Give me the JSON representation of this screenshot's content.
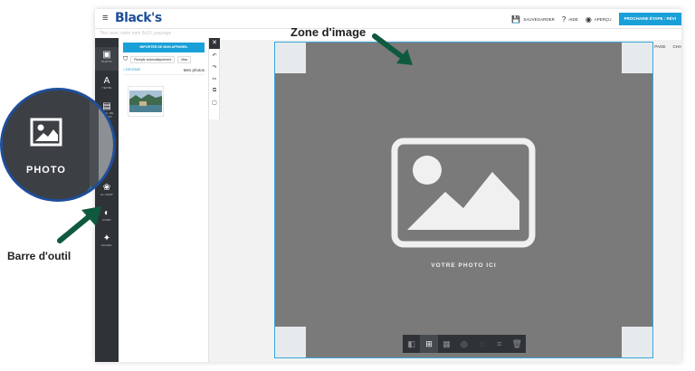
{
  "app": {
    "logo": "Black's",
    "hamburger": "≡",
    "project_title": "Titre avec votre nom 8x10, paysage"
  },
  "top_actions": [
    {
      "icon": "save-icon",
      "glyph": "💾",
      "label": "Sauvegarder"
    },
    {
      "icon": "help-icon",
      "glyph": "?",
      "label": "Aide"
    },
    {
      "icon": "eye-icon",
      "glyph": "◉",
      "label": "Aperçu"
    }
  ],
  "next_button": "Prochaine étape : révi",
  "context_actions": {
    "rearrange_label": "Réorganiser la mise en page",
    "trailing_label": "CHA"
  },
  "toolbar": [
    {
      "icon": "photo-icon",
      "glyph": "▣",
      "label": "Photo",
      "active": true
    },
    {
      "icon": "text-icon",
      "glyph": "A",
      "label": "Texte",
      "active": false
    },
    {
      "icon": "layout-icon",
      "glyph": "▤",
      "label": "Bloc de photo",
      "active": false
    },
    {
      "icon": "clipart-icon",
      "glyph": "❀",
      "label": "Cl-part",
      "active": false
    },
    {
      "icon": "palette-icon",
      "glyph": "◐",
      "label": "Fond",
      "active": false
    },
    {
      "icon": "effects-icon",
      "glyph": "✦",
      "label": "Accen.",
      "active": false
    }
  ],
  "panel": {
    "import_button": "Importer de mon appareil",
    "autofill": "Remplir automatiquement",
    "hide_label": "Mas",
    "back": "< Revenir",
    "heading": "Mes photos"
  },
  "canvas": {
    "placeholder": "Votre photo ici"
  },
  "callout": {
    "label": "PHOTO"
  },
  "annotations": {
    "zone": "Zone d'image",
    "toolbar": "Barre d'outil"
  },
  "colors": {
    "accent": "#1aa0d8",
    "brand": "#1f4e9a",
    "arrow": "#0f5a3e",
    "canvas": "#7a7a7a"
  }
}
